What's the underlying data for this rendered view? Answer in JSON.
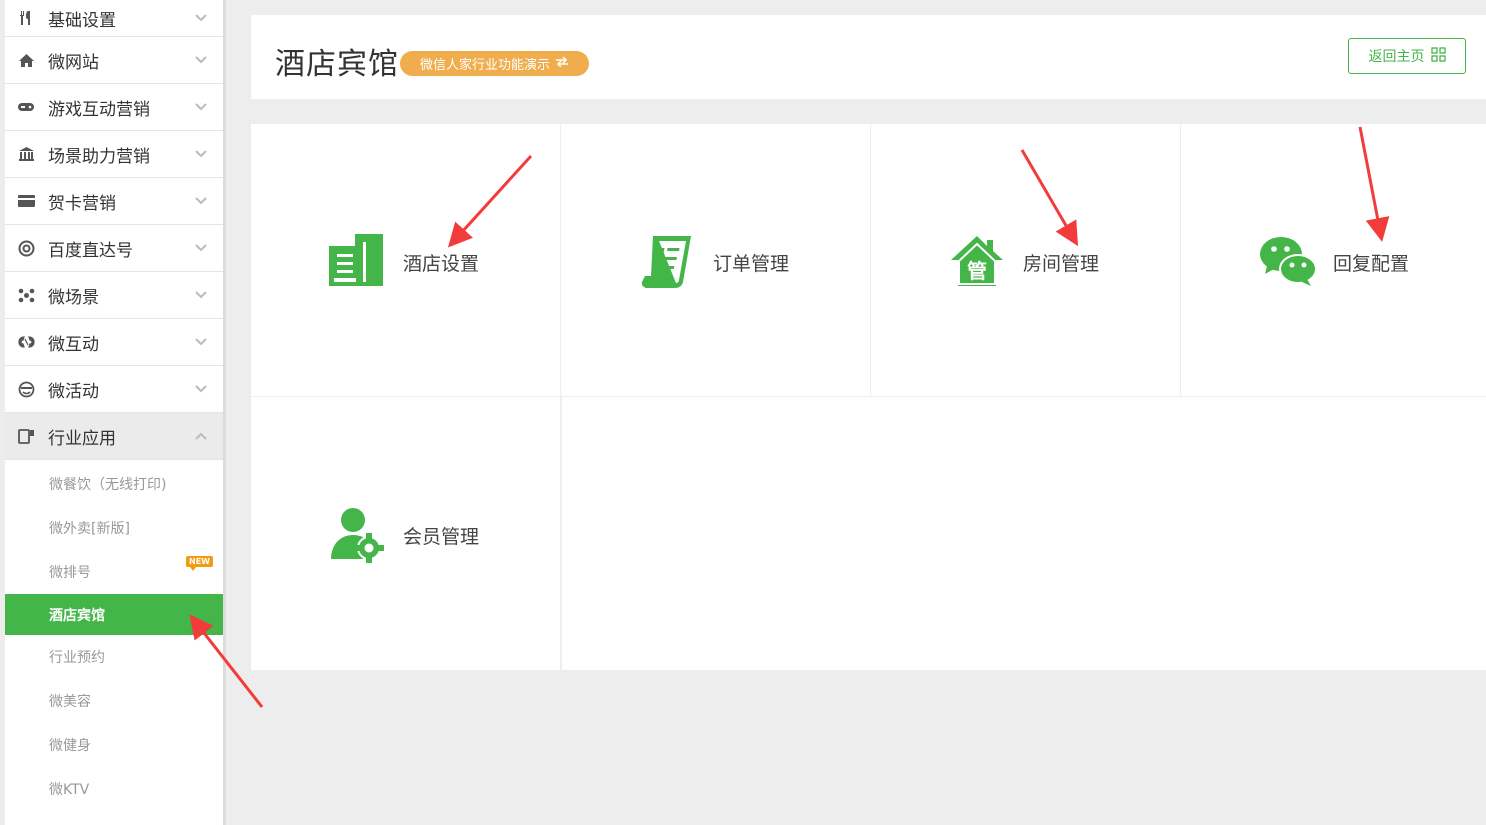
{
  "sidebar": {
    "items": [
      {
        "label": "基础设置",
        "icon": "cutlery-icon"
      },
      {
        "label": "微网站",
        "icon": "home-icon"
      },
      {
        "label": "游戏互动营销",
        "icon": "gamepad-icon"
      },
      {
        "label": "场景助力营销",
        "icon": "bank-icon"
      },
      {
        "label": "贺卡营销",
        "icon": "card-icon"
      },
      {
        "label": "百度直达号",
        "icon": "at-icon"
      },
      {
        "label": "微场景",
        "icon": "molecule-icon"
      },
      {
        "label": "微互动",
        "icon": "interact-icon"
      },
      {
        "label": "微活动",
        "icon": "smile-icon"
      },
      {
        "label": "行业应用",
        "icon": "industry-icon"
      }
    ],
    "sub_items": [
      {
        "label": "微餐饮（无线打印)"
      },
      {
        "label": "微外卖[新版]"
      },
      {
        "label": "微排号",
        "badge": "NEW"
      },
      {
        "label": "酒店宾馆"
      },
      {
        "label": "行业预约"
      },
      {
        "label": "微美容"
      },
      {
        "label": "微健身"
      },
      {
        "label": "微KTV"
      }
    ]
  },
  "header": {
    "title": "酒店宾馆",
    "demo_badge": "微信人家行业功能演示",
    "home_button": "返回主页"
  },
  "tiles": [
    {
      "label": "酒店设置",
      "icon": "building-icon"
    },
    {
      "label": "订单管理",
      "icon": "order-list-icon"
    },
    {
      "label": "房间管理",
      "icon": "house-manage-icon"
    },
    {
      "label": "回复配置",
      "icon": "wechat-icon"
    },
    {
      "label": "会员管理",
      "icon": "member-gear-icon"
    }
  ],
  "colors": {
    "accent": "#44b549",
    "badge": "#f0ad4e",
    "arrow": "#f23b3b"
  }
}
